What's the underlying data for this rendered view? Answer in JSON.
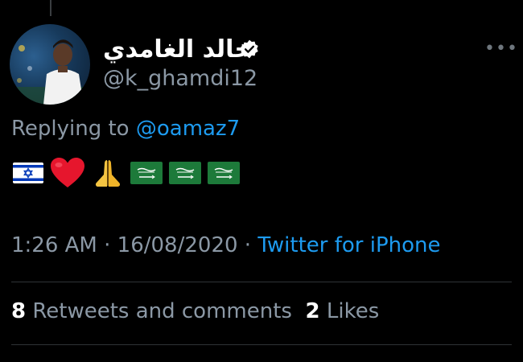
{
  "tweet": {
    "display_name": "خالد الغامدي",
    "handle": "@k_ghamdi12",
    "verified": true,
    "reply": {
      "prefix": "Replying to ",
      "mention": "@oamaz7"
    },
    "emojis": [
      "israel-flag",
      "red-heart",
      "folded-hands",
      "saudi-arabia-flag",
      "saudi-arabia-flag",
      "saudi-arabia-flag"
    ],
    "time": "1:26 AM",
    "date": "16/08/2020",
    "separator": "·",
    "source": "Twitter for iPhone",
    "stats": {
      "retweets_count": "8",
      "retweets_label": "Retweets and comments",
      "likes_count": "2",
      "likes_label": "Likes"
    },
    "more_icon": "more-horizontal-icon"
  },
  "colors": {
    "background": "#000000",
    "text_primary": "#ffffff",
    "text_secondary": "#8b98a5",
    "link": "#1d9bf0",
    "divider": "#2f3336"
  }
}
